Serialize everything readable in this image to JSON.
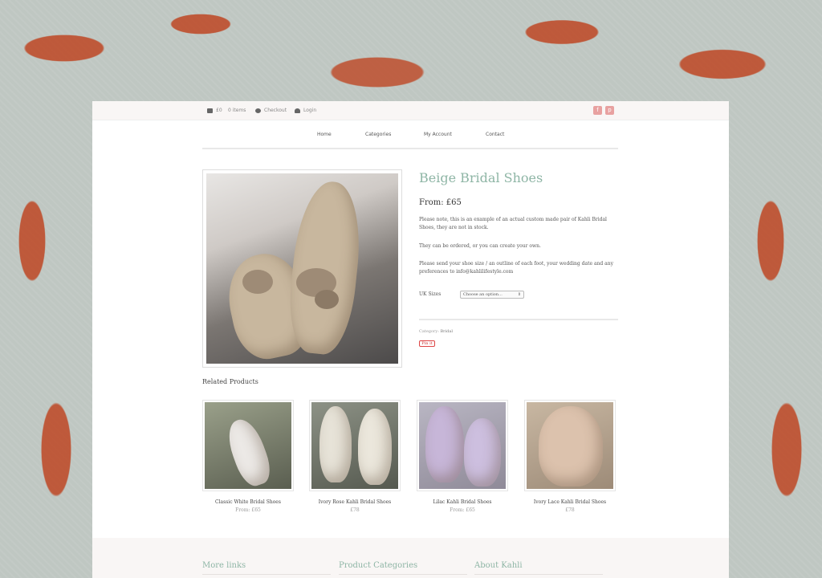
{
  "topbar": {
    "cart_amount": "£0",
    "cart_items": "0 items",
    "checkout": "Checkout",
    "login": "Login",
    "facebook": "f",
    "pinterest": "p"
  },
  "nav": {
    "home": "Home",
    "categories": "Categories",
    "my_account": "My Account",
    "contact": "Contact"
  },
  "product": {
    "title": "Beige Bridal Shoes",
    "price": "From: £65",
    "desc1": "Please note, this is an example of an actual custom made pair of Kahli Bridal Shoes, they are not in stock.",
    "desc2": "They can be ordered, or you can create your own.",
    "desc3": "Please send your shoe size / an outline of each foot, your wedding date and any preferences to info@kahlilifestyle.com",
    "size_label": "UK Sizes",
    "size_placeholder": "Choose an option...",
    "category_label": "Category:",
    "category_value": "Bridal",
    "pin_label": "Pin it"
  },
  "related": {
    "title": "Related Products",
    "items": [
      {
        "name": "Classic White Bridal Shoes",
        "price": "From: £65"
      },
      {
        "name": "Ivory Rose Kahli Bridal Shoes",
        "price": "£78"
      },
      {
        "name": "Lilac Kahli Bridal Shoes",
        "price": "From: £65"
      },
      {
        "name": "Ivory Lace Kahli Bridal Shoes",
        "price": "£78"
      }
    ]
  },
  "footer": {
    "more_links": "More links",
    "product_categories": "Product Categories",
    "about": "About Kahli"
  },
  "colors": {
    "accent": "#8eb5a5",
    "social": "#e8a1a0",
    "pattern": "#be4623"
  }
}
